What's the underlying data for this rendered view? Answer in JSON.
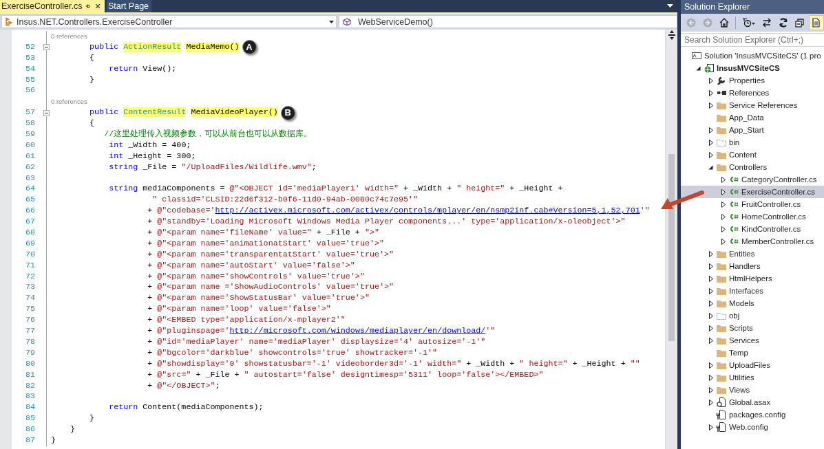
{
  "tabs": [
    {
      "label": "ExerciseController.cs",
      "selected": true
    },
    {
      "label": "Start Page",
      "selected": false
    }
  ],
  "navigation_bar": {
    "type_dropdown": "Insus.NET.Controllers.ExerciseController",
    "member_dropdown": "WebServiceDemo()"
  },
  "editor": {
    "lines": [
      {
        "kind": "lens",
        "text": "0 references"
      },
      {
        "kind": "code",
        "number": "52",
        "fold": true,
        "callout": "A",
        "segments": [
          {
            "kind": "keyword",
            "text": "        public "
          },
          {
            "kind": "type",
            "text": "ActionResult",
            "highlight": true
          },
          {
            "kind": "plain",
            "text": " MediaMemo()",
            "highlight": true
          }
        ]
      },
      {
        "kind": "code",
        "number": "53",
        "fold": false,
        "segments": [
          {
            "kind": "plain",
            "text": "        {"
          }
        ]
      },
      {
        "kind": "code",
        "number": "54",
        "fold": false,
        "segments": [
          {
            "kind": "keyword",
            "text": "            return"
          },
          {
            "kind": "plain",
            "text": " View();"
          }
        ]
      },
      {
        "kind": "code",
        "number": "55",
        "fold": false,
        "segments": [
          {
            "kind": "plain",
            "text": "        }"
          }
        ]
      },
      {
        "kind": "code",
        "number": "56",
        "fold": false
      },
      {
        "kind": "lens",
        "text": "0 references"
      },
      {
        "kind": "code",
        "number": "57",
        "fold": true,
        "callout": "B",
        "segments": [
          {
            "kind": "keyword",
            "text": "        public "
          },
          {
            "kind": "type",
            "text": "ContentResult",
            "highlight": true
          },
          {
            "kind": "plain",
            "text": " MediaVideoPlayer()",
            "highlight": true
          }
        ]
      },
      {
        "kind": "code",
        "number": "58",
        "fold": false,
        "segments": [
          {
            "kind": "plain",
            "text": "        {"
          }
        ]
      },
      {
        "kind": "code",
        "number": "59",
        "fold": false,
        "segments": [
          {
            "kind": "comment",
            "text": "           //这里处理传入视频参数，可以从前台也可以从数据库。"
          }
        ]
      },
      {
        "kind": "code",
        "number": "60",
        "fold": false,
        "segments": [
          {
            "kind": "keyword",
            "text": "            int"
          },
          {
            "kind": "plain",
            "text": " _Width = 400;"
          }
        ]
      },
      {
        "kind": "code",
        "number": "61",
        "fold": false,
        "segments": [
          {
            "kind": "keyword",
            "text": "            int"
          },
          {
            "kind": "plain",
            "text": " _Height = 300;"
          }
        ]
      },
      {
        "kind": "code",
        "number": "62",
        "fold": false,
        "segments": [
          {
            "kind": "keyword",
            "text": "            string"
          },
          {
            "kind": "plain",
            "text": " _File = "
          },
          {
            "kind": "string",
            "text": "\"/UploadFiles/Wildlife.wmv\""
          },
          {
            "kind": "plain",
            "text": ";"
          }
        ]
      },
      {
        "kind": "code",
        "number": "63",
        "fold": false
      },
      {
        "kind": "code",
        "number": "64",
        "fold": false,
        "segments": [
          {
            "kind": "keyword",
            "text": "            string"
          },
          {
            "kind": "plain",
            "text": " mediaComponents = "
          },
          {
            "kind": "string",
            "text": "@\"<OBJECT id='mediaPlayer1' width=\""
          },
          {
            "kind": "plain",
            "text": " + _Width + "
          },
          {
            "kind": "string",
            "text": "\" height=\""
          },
          {
            "kind": "plain",
            "text": " + _Height +"
          }
        ]
      },
      {
        "kind": "code",
        "number": "65",
        "fold": false,
        "segments": [
          {
            "kind": "string",
            "text": "                     \" classid='CLSID:22d6f312-b0f6-11d0-94ab-0080c74c7e95'\""
          }
        ]
      },
      {
        "kind": "code",
        "number": "66",
        "fold": false,
        "segments": [
          {
            "kind": "plain",
            "text": "                    + "
          },
          {
            "kind": "string",
            "text": "@\"codebase='"
          },
          {
            "kind": "link",
            "text": "http://activex.microsoft.com/activex/controls/mplayer/en/nsmp2inf.cab#Version=5,1,52,701"
          },
          {
            "kind": "string",
            "text": "'\""
          }
        ]
      },
      {
        "kind": "code",
        "number": "67",
        "fold": false,
        "segments": [
          {
            "kind": "plain",
            "text": "                    + "
          },
          {
            "kind": "string",
            "text": "@\"standby='Loading Microsoft Windows Media Player components...' type='application/x-oleobject'>\""
          }
        ]
      },
      {
        "kind": "code",
        "number": "68",
        "fold": false,
        "segments": [
          {
            "kind": "plain",
            "text": "                    + "
          },
          {
            "kind": "string",
            "text": "@\"<param name='fileName' value=\""
          },
          {
            "kind": "plain",
            "text": " + _File + "
          },
          {
            "kind": "string",
            "text": "\">\""
          }
        ]
      },
      {
        "kind": "code",
        "number": "69",
        "fold": false,
        "segments": [
          {
            "kind": "plain",
            "text": "                    + "
          },
          {
            "kind": "string",
            "text": "@\"<param name='animationatStart' value='true'>\""
          }
        ]
      },
      {
        "kind": "code",
        "number": "70",
        "fold": false,
        "segments": [
          {
            "kind": "plain",
            "text": "                    + "
          },
          {
            "kind": "string",
            "text": "@\"<param name='transparentatStart' value='true'>\""
          }
        ]
      },
      {
        "kind": "code",
        "number": "71",
        "fold": false,
        "segments": [
          {
            "kind": "plain",
            "text": "                    + "
          },
          {
            "kind": "string",
            "text": "@\"<param name='autoStart' value='false'>\""
          }
        ]
      },
      {
        "kind": "code",
        "number": "72",
        "fold": false,
        "segments": [
          {
            "kind": "plain",
            "text": "                    + "
          },
          {
            "kind": "string",
            "text": "@\"<param name='showControls' value='true'>\""
          }
        ]
      },
      {
        "kind": "code",
        "number": "73",
        "fold": false,
        "segments": [
          {
            "kind": "plain",
            "text": "                    + "
          },
          {
            "kind": "string",
            "text": "@\"<param name ='ShowAudioControls' value='true'>\""
          }
        ]
      },
      {
        "kind": "code",
        "number": "74",
        "fold": false,
        "segments": [
          {
            "kind": "plain",
            "text": "                    + "
          },
          {
            "kind": "string",
            "text": "@\"<param name='ShowStatusBar' value='true'>\""
          }
        ]
      },
      {
        "kind": "code",
        "number": "75",
        "fold": false,
        "segments": [
          {
            "kind": "plain",
            "text": "                    + "
          },
          {
            "kind": "string",
            "text": "@\"<param name='loop' value='false'>\""
          }
        ]
      },
      {
        "kind": "code",
        "number": "76",
        "fold": false,
        "segments": [
          {
            "kind": "plain",
            "text": "                    + "
          },
          {
            "kind": "string",
            "text": "@\"<EMBED type='application/x-mplayer2'\""
          }
        ]
      },
      {
        "kind": "code",
        "number": "77",
        "fold": false,
        "segments": [
          {
            "kind": "plain",
            "text": "                    + "
          },
          {
            "kind": "string",
            "text": "@\"pluginspage='"
          },
          {
            "kind": "link",
            "text": "http://microsoft.com/windows/mediaplayer/en/download/"
          },
          {
            "kind": "string",
            "text": "'\""
          }
        ]
      },
      {
        "kind": "code",
        "number": "78",
        "fold": false,
        "segments": [
          {
            "kind": "plain",
            "text": "                    + "
          },
          {
            "kind": "string",
            "text": "@\"id='mediaPlayer' name='mediaPlayer' displaysize='4' autosize='-1'\""
          }
        ]
      },
      {
        "kind": "code",
        "number": "79",
        "fold": false,
        "segments": [
          {
            "kind": "plain",
            "text": "                    + "
          },
          {
            "kind": "string",
            "text": "@\"bgcolor='darkblue' showcontrols='true' showtracker='-1'\""
          }
        ]
      },
      {
        "kind": "code",
        "number": "80",
        "fold": false,
        "segments": [
          {
            "kind": "plain",
            "text": "                    + "
          },
          {
            "kind": "string",
            "text": "@\"showdisplay='0' showstatusbar='-1' videoborder3d='-1' width=\""
          },
          {
            "kind": "plain",
            "text": " + _Width + "
          },
          {
            "kind": "string",
            "text": "\" height=\""
          },
          {
            "kind": "plain",
            "text": " + _Height + "
          },
          {
            "kind": "string",
            "text": "\"\""
          }
        ]
      },
      {
        "kind": "code",
        "number": "81",
        "fold": false,
        "segments": [
          {
            "kind": "plain",
            "text": "                    + "
          },
          {
            "kind": "string",
            "text": "@\"src=\""
          },
          {
            "kind": "plain",
            "text": " + _File + "
          },
          {
            "kind": "string",
            "text": "\" autostart='false' designtimesp='5311' loop='false'></EMBED>\""
          }
        ]
      },
      {
        "kind": "code",
        "number": "82",
        "fold": false,
        "segments": [
          {
            "kind": "plain",
            "text": "                    + "
          },
          {
            "kind": "string",
            "text": "@\"</OBJECT>\""
          },
          {
            "kind": "plain",
            "text": ";"
          }
        ]
      },
      {
        "kind": "code",
        "number": "83",
        "fold": false
      },
      {
        "kind": "code",
        "number": "84",
        "fold": false,
        "segments": [
          {
            "kind": "keyword",
            "text": "            return"
          },
          {
            "kind": "plain",
            "text": " Content(mediaComponents);"
          }
        ]
      },
      {
        "kind": "code",
        "number": "85",
        "fold": false,
        "segments": [
          {
            "kind": "plain",
            "text": "        }"
          }
        ]
      },
      {
        "kind": "code",
        "number": "86",
        "fold": false,
        "segments": [
          {
            "kind": "plain",
            "text": "    }"
          }
        ]
      },
      {
        "kind": "code",
        "number": "87",
        "fold": false,
        "segments": [
          {
            "kind": "plain",
            "text": "}"
          }
        ]
      }
    ]
  },
  "solution_explorer": {
    "title": "Solution Explorer",
    "toolbar": [
      {
        "kind": "back",
        "disabled": true,
        "on": false
      },
      {
        "kind": "forward",
        "disabled": true,
        "on": false
      },
      {
        "kind": "home",
        "disabled": false,
        "on": false
      },
      {
        "kind": "history",
        "disabled": false,
        "on": false
      },
      {
        "kind": "sync",
        "disabled": false,
        "on": false
      },
      {
        "kind": "refresh",
        "disabled": false,
        "on": false
      },
      {
        "kind": "collapse",
        "disabled": false,
        "on": false
      },
      {
        "kind": "show-all",
        "disabled": false,
        "on": true
      }
    ],
    "search": {
      "placeholder": "Search Solution Explorer (Ctrl+;)"
    },
    "tree": [
      {
        "label": "Solution 'InsusMVCSiteCS' (1 pro",
        "kind": "solution",
        "selected": false,
        "children": [
          {
            "label": "InsusMVCSiteCS",
            "kind": "project",
            "expanded": true,
            "selected": false,
            "children": [
              {
                "label": "Properties",
                "kind": "properties",
                "expanded": false,
                "selected": false
              },
              {
                "label": "References",
                "kind": "references",
                "expanded": false,
                "selected": false
              },
              {
                "label": "Service References",
                "kind": "folder",
                "expanded": false,
                "selected": false
              },
              {
                "label": "App_Data",
                "kind": "folder",
                "selected": false
              },
              {
                "label": "App_Start",
                "kind": "folder",
                "expanded": false,
                "selected": false
              },
              {
                "label": "bin",
                "kind": "hidden-folder",
                "expanded": false,
                "selected": false
              },
              {
                "label": "Content",
                "kind": "folder",
                "expanded": false,
                "selected": false
              },
              {
                "label": "Controllers",
                "kind": "folder",
                "expanded": true,
                "selected": false,
                "children": [
                  {
                    "label": "CategoryController.cs",
                    "kind": "csharp",
                    "expanded": false,
                    "selected": false
                  },
                  {
                    "label": "ExerciseController.cs",
                    "kind": "csharp",
                    "expanded": false,
                    "selected": true
                  },
                  {
                    "label": "FruitController.cs",
                    "kind": "csharp",
                    "expanded": false,
                    "selected": false
                  },
                  {
                    "label": "HomeController.cs",
                    "kind": "csharp",
                    "expanded": false,
                    "selected": false
                  },
                  {
                    "label": "KindController.cs",
                    "kind": "csharp",
                    "expanded": false,
                    "selected": false
                  },
                  {
                    "label": "MemberController.cs",
                    "kind": "csharp",
                    "expanded": false,
                    "selected": false
                  }
                ]
              },
              {
                "label": "Entities",
                "kind": "folder",
                "expanded": false,
                "selected": false
              },
              {
                "label": "Handlers",
                "kind": "folder",
                "expanded": false,
                "selected": false
              },
              {
                "label": "HtmlHelpers",
                "kind": "folder",
                "expanded": false,
                "selected": false
              },
              {
                "label": "Interfaces",
                "kind": "folder",
                "expanded": false,
                "selected": false
              },
              {
                "label": "Models",
                "kind": "folder",
                "expanded": false,
                "selected": false
              },
              {
                "label": "obj",
                "kind": "hidden-folder",
                "expanded": false,
                "selected": false
              },
              {
                "label": "Scripts",
                "kind": "folder",
                "expanded": false,
                "selected": false
              },
              {
                "label": "Services",
                "kind": "folder",
                "expanded": false,
                "selected": false
              },
              {
                "label": "Temp",
                "kind": "folder",
                "selected": false
              },
              {
                "label": "UploadFiles",
                "kind": "folder",
                "expanded": false,
                "selected": false
              },
              {
                "label": "Utilities",
                "kind": "folder",
                "expanded": false,
                "selected": false
              },
              {
                "label": "Views",
                "kind": "folder",
                "expanded": false,
                "selected": false
              },
              {
                "label": "Global.asax",
                "kind": "asax",
                "expanded": false,
                "selected": false
              },
              {
                "label": "packages.config",
                "kind": "config",
                "selected": false
              },
              {
                "label": "Web.config",
                "kind": "config",
                "expanded": false,
                "selected": false
              }
            ]
          }
        ]
      }
    ]
  }
}
